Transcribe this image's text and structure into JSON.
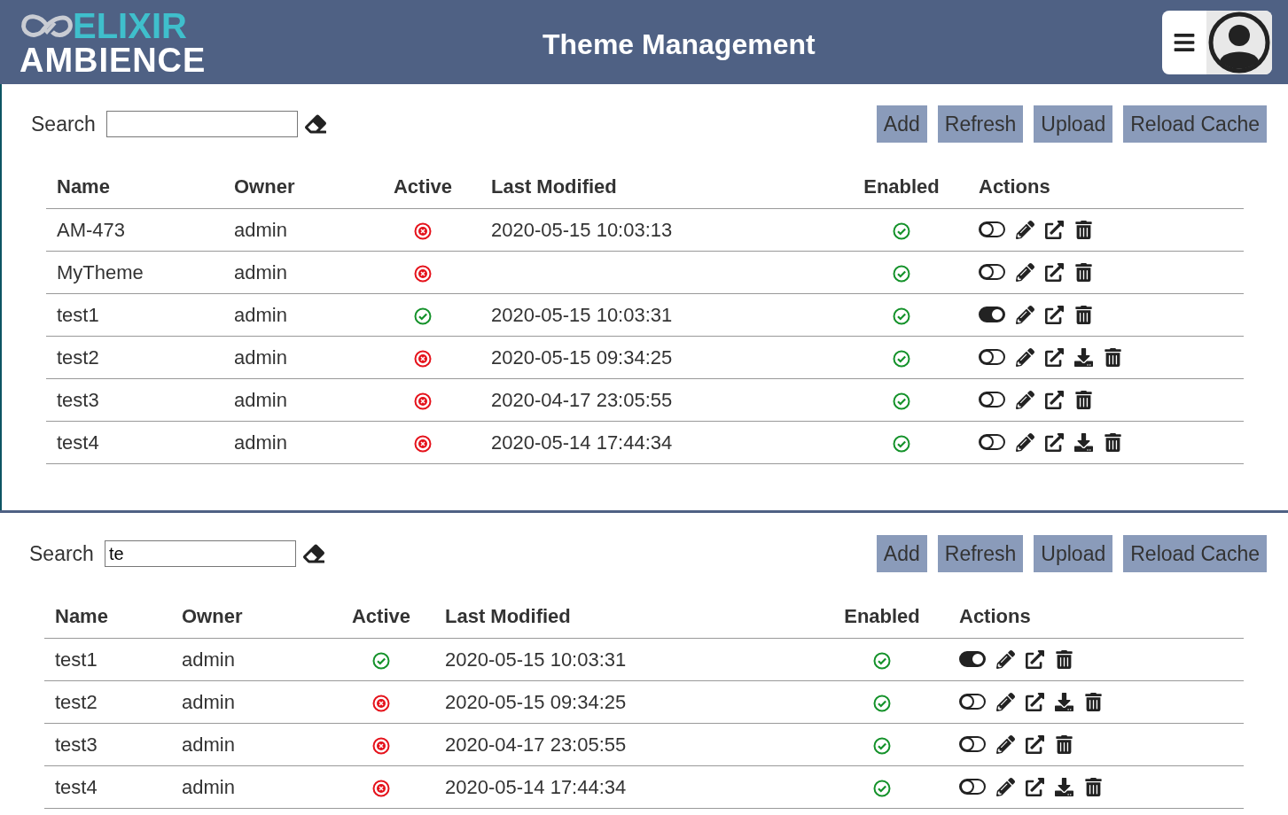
{
  "header": {
    "logo_top": "ELIXIR",
    "logo_bottom": "AMBIENCE",
    "title": "Theme Management"
  },
  "panels": [
    {
      "search": {
        "label": "Search"
      },
      "buttons": [
        "Add",
        "Refresh",
        "Upload",
        "Reload Cache"
      ],
      "columns": [
        "Name",
        "Owner",
        "Active",
        "Last Modified",
        "Enabled",
        "Actions"
      ],
      "rows": [
        {
          "name": "AM-473",
          "owner": "admin",
          "active": false,
          "modified": "2020-05-15 10:03:13",
          "enabled": true,
          "actions": [
            {
              "kind": "toggle",
              "on": false
            },
            {
              "kind": "edit"
            },
            {
              "kind": "open"
            },
            {
              "kind": "delete"
            }
          ]
        },
        {
          "name": "MyTheme",
          "owner": "admin",
          "active": false,
          "enabled": true,
          "actions": [
            {
              "kind": "toggle",
              "on": false
            },
            {
              "kind": "edit"
            },
            {
              "kind": "open"
            },
            {
              "kind": "delete"
            }
          ]
        },
        {
          "name": "test1",
          "owner": "admin",
          "active": true,
          "modified": "2020-05-15 10:03:31",
          "enabled": true,
          "actions": [
            {
              "kind": "toggle",
              "on": true
            },
            {
              "kind": "edit"
            },
            {
              "kind": "open"
            },
            {
              "kind": "delete"
            }
          ]
        },
        {
          "name": "test2",
          "owner": "admin",
          "active": false,
          "modified": "2020-05-15 09:34:25",
          "enabled": true,
          "actions": [
            {
              "kind": "toggle",
              "on": false
            },
            {
              "kind": "edit"
            },
            {
              "kind": "open"
            },
            {
              "kind": "download"
            },
            {
              "kind": "delete"
            }
          ]
        },
        {
          "name": "test3",
          "owner": "admin",
          "active": false,
          "modified": "2020-04-17 23:05:55",
          "enabled": true,
          "actions": [
            {
              "kind": "toggle",
              "on": false
            },
            {
              "kind": "edit"
            },
            {
              "kind": "open"
            },
            {
              "kind": "delete"
            }
          ]
        },
        {
          "name": "test4",
          "owner": "admin",
          "active": false,
          "modified": "2020-05-14 17:44:34",
          "enabled": true,
          "actions": [
            {
              "kind": "toggle",
              "on": false
            },
            {
              "kind": "edit"
            },
            {
              "kind": "open"
            },
            {
              "kind": "download"
            },
            {
              "kind": "delete"
            }
          ]
        }
      ]
    },
    {
      "search": {
        "label": "Search",
        "value": "te"
      },
      "buttons": [
        "Add",
        "Refresh",
        "Upload",
        "Reload Cache"
      ],
      "columns": [
        "Name",
        "Owner",
        "Active",
        "Last Modified",
        "Enabled",
        "Actions"
      ],
      "rows": [
        {
          "name": "test1",
          "owner": "admin",
          "active": true,
          "modified": "2020-05-15 10:03:31",
          "enabled": true,
          "actions": [
            {
              "kind": "toggle",
              "on": true
            },
            {
              "kind": "edit"
            },
            {
              "kind": "open"
            },
            {
              "kind": "delete"
            }
          ]
        },
        {
          "name": "test2",
          "owner": "admin",
          "active": false,
          "modified": "2020-05-15 09:34:25",
          "enabled": true,
          "actions": [
            {
              "kind": "toggle",
              "on": false
            },
            {
              "kind": "edit"
            },
            {
              "kind": "open"
            },
            {
              "kind": "download"
            },
            {
              "kind": "delete"
            }
          ]
        },
        {
          "name": "test3",
          "owner": "admin",
          "active": false,
          "modified": "2020-04-17 23:05:55",
          "enabled": true,
          "actions": [
            {
              "kind": "toggle",
              "on": false
            },
            {
              "kind": "edit"
            },
            {
              "kind": "open"
            },
            {
              "kind": "delete"
            }
          ]
        },
        {
          "name": "test4",
          "owner": "admin",
          "active": false,
          "modified": "2020-05-14 17:44:34",
          "enabled": true,
          "actions": [
            {
              "kind": "toggle",
              "on": false
            },
            {
              "kind": "edit"
            },
            {
              "kind": "open"
            },
            {
              "kind": "download"
            },
            {
              "kind": "delete"
            }
          ]
        }
      ]
    }
  ]
}
